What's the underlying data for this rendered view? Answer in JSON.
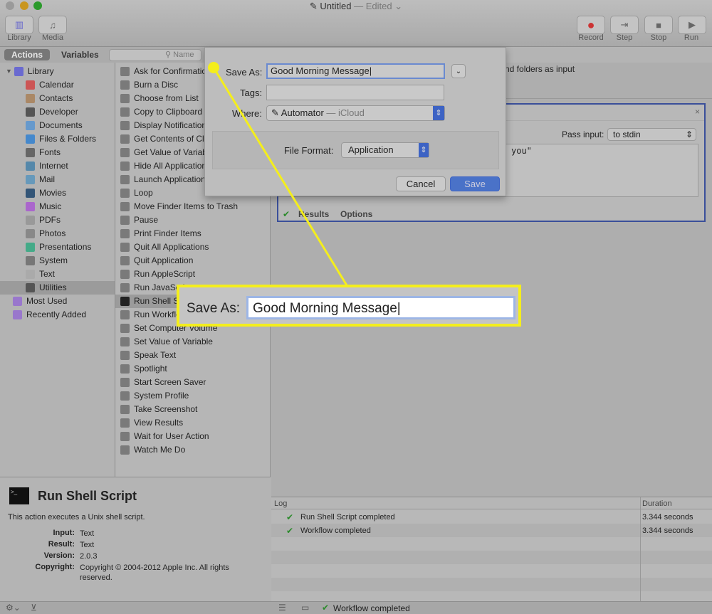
{
  "window": {
    "title": "Untitled",
    "status": "— Edited ⌄"
  },
  "toolbar": {
    "library": "Library",
    "media": "Media",
    "record": "Record",
    "step": "Step",
    "stop": "Stop",
    "run": "Run"
  },
  "tabs": {
    "actions": "Actions",
    "variables": "Variables"
  },
  "search": {
    "placeholder": "Name"
  },
  "library": {
    "items": [
      {
        "label": "Library",
        "color": "#6a6ad0"
      },
      {
        "label": "Calendar",
        "color": "#c55"
      },
      {
        "label": "Contacts",
        "color": "#a86"
      },
      {
        "label": "Developer",
        "color": "#555"
      },
      {
        "label": "Documents",
        "color": "#69c"
      },
      {
        "label": "Files & Folders",
        "color": "#48c"
      },
      {
        "label": "Fonts",
        "color": "#666"
      },
      {
        "label": "Internet",
        "color": "#58a"
      },
      {
        "label": "Mail",
        "color": "#69b"
      },
      {
        "label": "Movies",
        "color": "#357"
      },
      {
        "label": "Music",
        "color": "#a6c"
      },
      {
        "label": "PDFs",
        "color": "#999"
      },
      {
        "label": "Photos",
        "color": "#888"
      },
      {
        "label": "Presentations",
        "color": "#4a8"
      },
      {
        "label": "System",
        "color": "#777"
      },
      {
        "label": "Text",
        "color": "#aaa"
      },
      {
        "label": "Utilities",
        "color": "#555"
      },
      {
        "label": "Most Used",
        "color": "#97c"
      },
      {
        "label": "Recently Added",
        "color": "#97c"
      }
    ]
  },
  "actions": {
    "items": [
      "Ask for Confirmation",
      "Burn a Disc",
      "Choose from List",
      "Copy to Clipboard",
      "Display Notification",
      "Get Contents of Clipboard",
      "Get Value of Variable",
      "Hide All Applications",
      "Launch Application",
      "Loop",
      "Move Finder Items to Trash",
      "Pause",
      "Print Finder Items",
      "Quit All Applications",
      "Quit Application",
      "Run AppleScript",
      "Run JavaScript",
      "Run Shell Script",
      "Run Workflow",
      "Set Computer Volume",
      "Set Value of Variable",
      "Speak Text",
      "Spotlight",
      "Start Screen Saver",
      "System Profile",
      "Take Screenshot",
      "View Results",
      "Wait for User Action",
      "Watch Me Do"
    ]
  },
  "info": {
    "title": "Run Shell Script",
    "description": "This action executes a Unix shell script.",
    "fields": [
      {
        "k": "Input:",
        "v": "Text"
      },
      {
        "k": "Result:",
        "v": "Text"
      },
      {
        "k": "Version:",
        "v": "2.0.3"
      },
      {
        "k": "Copyright:",
        "v": "Copyright © 2004-2012 Apple Inc.  All rights reserved."
      }
    ]
  },
  "workflow": {
    "header_text": "nd folders as input",
    "pass_input_label": "Pass input:",
    "pass_input_value": "to stdin",
    "script_text": "you\"",
    "results_tab": "Results",
    "options_tab": "Options"
  },
  "log": {
    "col_log": "Log",
    "col_duration": "Duration",
    "rows": [
      {
        "msg": "Run Shell Script completed",
        "dur": "3.344 seconds"
      },
      {
        "msg": "Workflow completed",
        "dur": "3.344 seconds"
      }
    ]
  },
  "statusbar": {
    "text": "Workflow completed"
  },
  "dialog": {
    "save_as_label": "Save As:",
    "save_as_value": "Good Morning Message",
    "tags_label": "Tags:",
    "where_label": "Where:",
    "where_value": "Automator",
    "where_suffix": "— iCloud",
    "file_format_label": "File Format:",
    "file_format_value": "Application",
    "cancel": "Cancel",
    "save": "Save"
  },
  "callout": {
    "label": "Save As:",
    "value": "Good Morning Message",
    "color": "#f4ee1c"
  }
}
